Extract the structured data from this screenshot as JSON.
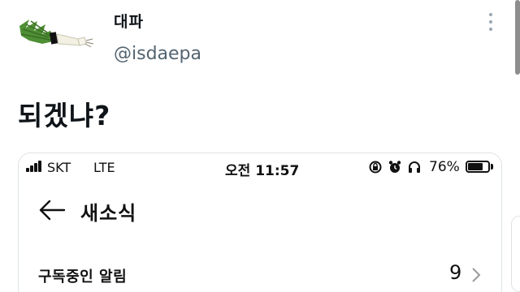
{
  "tweet": {
    "author": {
      "display_name": "대파",
      "handle": "@isdaepa",
      "avatar_icon": "green-onion-icon"
    },
    "text": "되겠냐?",
    "menu_icon": "more-vertical-icon"
  },
  "embedded_screenshot": {
    "status_bar": {
      "carrier": "SKT",
      "network": "LTE",
      "time": "오전 11:57",
      "battery_percent": "76%",
      "battery_level": 0.76,
      "icons": [
        "screen-rotation-lock-icon",
        "alarm-clock-icon",
        "headphones-icon"
      ]
    },
    "nav": {
      "back_icon": "arrow-left-icon",
      "title": "새소식"
    },
    "list": [
      {
        "label": "구독중인 알림",
        "count": "9",
        "chevron_icon": "chevron-right-icon"
      }
    ]
  },
  "colors": {
    "text_primary": "#0f1419",
    "text_secondary": "#536471",
    "border": "#dfe3e6",
    "onion_green": "#5a9a3c",
    "onion_white": "#f2f0e2"
  }
}
